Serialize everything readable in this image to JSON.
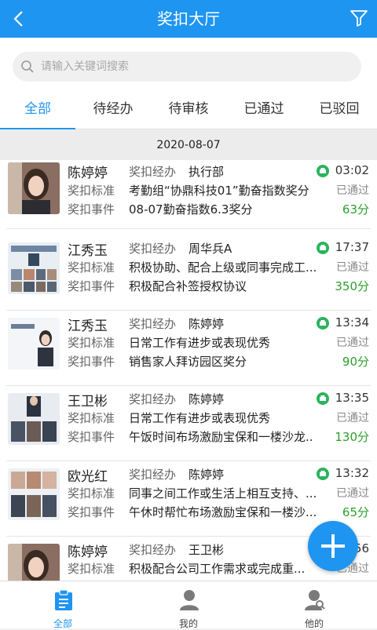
{
  "header": {
    "title": "奖扣大厅"
  },
  "search": {
    "placeholder": "请输入关键词搜索"
  },
  "tabs": [
    "全部",
    "待经办",
    "待审核",
    "已通过",
    "已驳回"
  ],
  "date": "2020-08-07",
  "labels": {
    "handler": "奖扣经办",
    "standard": "奖扣标准",
    "event": "奖扣事件"
  },
  "records": [
    {
      "name": "陈婷婷",
      "handler": "执行部",
      "time": "03:02",
      "standard": "考勤组“协鼎科技01”勤奋指数奖分",
      "status": "已通过",
      "event": "08-07勤奋指数6.3奖分",
      "points": "63分"
    },
    {
      "name": "江秀玉",
      "handler": "周华兵A",
      "time": "17:37",
      "standard": "积极协助、配合上级或同事完成工...",
      "status": "已通过",
      "event": "积极配合补签授权协议",
      "points": "350分"
    },
    {
      "name": "江秀玉",
      "handler": "陈婷婷",
      "time": "13:34",
      "standard": "日常工作有进步或表现优秀",
      "status": "已通过",
      "event": "销售家人拜访园区奖分",
      "points": "90分"
    },
    {
      "name": "王卫彬",
      "handler": "陈婷婷",
      "time": "13:35",
      "standard": "日常工作有进步或表现优秀",
      "status": "已通过",
      "event": "午饭时间布场激励宝保和一楼沙龙...",
      "points": "130分"
    },
    {
      "name": "欧光红",
      "handler": "陈婷婷",
      "time": "13:32",
      "standard": "同事之间工作或生活上相互支持、...",
      "status": "已通过",
      "event": "午休时帮忙布场激励宝保和一楼沙...",
      "points": "65分"
    },
    {
      "name": "陈婷婷",
      "handler": "王卫彬",
      "time": "56",
      "standard": "积极配合公司工作需求或完成重...",
      "status": "已通过",
      "event": "",
      "points": ""
    }
  ],
  "bottom_nav": [
    "全部",
    "我的",
    "他的"
  ],
  "colors": {
    "primary": "#1e95f0",
    "points": "#2e9e2e"
  }
}
